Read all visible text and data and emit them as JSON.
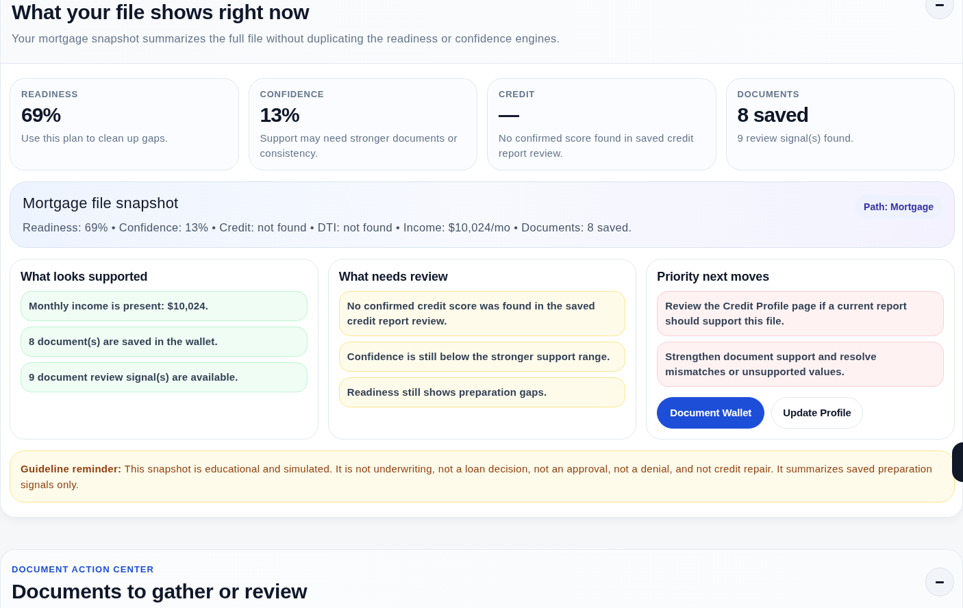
{
  "overview": {
    "title": "What your file shows right now",
    "subtitle": "Your mortgage snapshot summarizes the full file without duplicating the readiness or confidence engines."
  },
  "stats": [
    {
      "label": "READINESS",
      "value": "69%",
      "note": "Use this plan to clean up gaps."
    },
    {
      "label": "CONFIDENCE",
      "value": "13%",
      "note": "Support may need stronger documents or consistency."
    },
    {
      "label": "CREDIT",
      "value": "—",
      "note": "No confirmed score found in saved credit report review."
    },
    {
      "label": "DOCUMENTS",
      "value": "8 saved",
      "note": "9 review signal(s) found."
    }
  ],
  "snapshot": {
    "title": "Mortgage file snapshot",
    "summary": "Readiness: 69% • Confidence: 13% • Credit: not found • DTI: not found • Income: $10,024/mo • Documents: 8 saved.",
    "badge": "Path: Mortgage"
  },
  "panels": [
    {
      "kind": "supported",
      "title": "What looks supported",
      "items": [
        "Monthly income is present: $10,024.",
        "8 document(s) are saved in the wallet.",
        "9 document review signal(s) are available."
      ]
    },
    {
      "kind": "review",
      "title": "What needs review",
      "items": [
        "No confirmed credit score was found in the saved credit report review.",
        "Confidence is still below the stronger support range.",
        "Readiness still shows preparation gaps."
      ]
    },
    {
      "kind": "priority",
      "title": "Priority next moves",
      "items": [
        "Review the Credit Profile page if a current report should support this file.",
        "Strengthen document support and resolve mismatches or unsupported values."
      ],
      "actions": [
        {
          "label": "Document Wallet",
          "kind": "primary"
        },
        {
          "label": "Update Profile",
          "kind": "secondary"
        }
      ]
    }
  ],
  "guideline": {
    "text": "**Guideline reminder:** This snapshot is educational and simulated. It is not underwriting, not a loan decision, not an approval, not a denial, and not credit repair. It summarizes saved preparation signals only."
  },
  "document_center": {
    "eyebrow": "DOCUMENT ACTION CENTER",
    "title": "Documents to gather or review"
  }
}
